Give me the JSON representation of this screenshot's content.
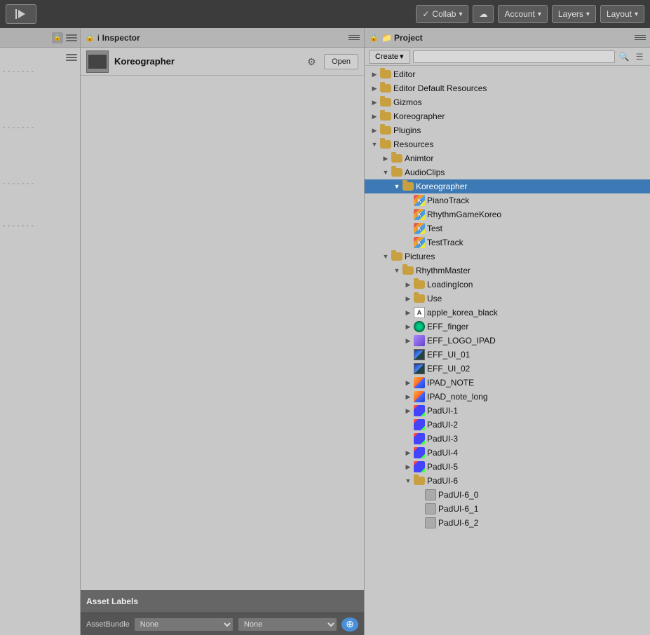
{
  "toolbar": {
    "play_label": "▶|",
    "collab_label": "Collab",
    "cloud_label": "☁",
    "account_label": "Account",
    "layers_label": "Layers",
    "layout_label": "Layout",
    "arrow": "▾"
  },
  "inspector": {
    "title": "Inspector",
    "asset_name": "Koreographer",
    "open_btn": "Open",
    "asset_labels": "Asset Labels",
    "asset_bundle_label": "AssetBundle",
    "asset_bundle_none1": "None",
    "asset_bundle_none2": "None"
  },
  "project": {
    "title": "Project",
    "create_btn": "Create",
    "tree": [
      {
        "id": "editor",
        "label": "Editor",
        "indent": 0,
        "type": "folder",
        "arrow": "▶",
        "selected": false
      },
      {
        "id": "editor-default-resources",
        "label": "Editor Default Resources",
        "indent": 0,
        "type": "folder",
        "arrow": "▶",
        "selected": false
      },
      {
        "id": "gizmos",
        "label": "Gizmos",
        "indent": 0,
        "type": "folder",
        "arrow": "▶",
        "selected": false
      },
      {
        "id": "koreographer-root",
        "label": "Koreographer",
        "indent": 0,
        "type": "folder",
        "arrow": "▶",
        "selected": false
      },
      {
        "id": "plugins",
        "label": "Plugins",
        "indent": 0,
        "type": "folder",
        "arrow": "▶",
        "selected": false
      },
      {
        "id": "resources",
        "label": "Resources",
        "indent": 0,
        "type": "folder-open",
        "arrow": "▼",
        "selected": false
      },
      {
        "id": "animtor",
        "label": "Animtor",
        "indent": 1,
        "type": "folder",
        "arrow": "▶",
        "selected": false
      },
      {
        "id": "audioclips",
        "label": "AudioClips",
        "indent": 1,
        "type": "folder-open",
        "arrow": "▼",
        "selected": false
      },
      {
        "id": "koreographer",
        "label": "Koreographer",
        "indent": 2,
        "type": "folder-open",
        "arrow": "▼",
        "selected": true
      },
      {
        "id": "pianotrack",
        "label": "PianoTrack",
        "indent": 3,
        "type": "koreo",
        "arrow": "",
        "selected": false
      },
      {
        "id": "rhythmgamekoreo",
        "label": "RhythmGameKoreo",
        "indent": 3,
        "type": "koreo",
        "arrow": "",
        "selected": false
      },
      {
        "id": "test",
        "label": "Test",
        "indent": 3,
        "type": "koreo",
        "arrow": "",
        "selected": false
      },
      {
        "id": "testtrack",
        "label": "TestTrack",
        "indent": 3,
        "type": "koreo",
        "arrow": "",
        "selected": false
      },
      {
        "id": "pictures",
        "label": "Pictures",
        "indent": 1,
        "type": "folder-open",
        "arrow": "▼",
        "selected": false
      },
      {
        "id": "rhythmmaster",
        "label": "RhythmMaster",
        "indent": 2,
        "type": "folder-open",
        "arrow": "▼",
        "selected": false
      },
      {
        "id": "loadingicon",
        "label": "LoadingIcon",
        "indent": 3,
        "type": "folder",
        "arrow": "▶",
        "selected": false
      },
      {
        "id": "use",
        "label": "Use",
        "indent": 3,
        "type": "folder",
        "arrow": "▶",
        "selected": false
      },
      {
        "id": "apple-korea-black",
        "label": "apple_korea_black",
        "indent": 3,
        "type": "text",
        "arrow": "▶",
        "selected": false
      },
      {
        "id": "eff-finger",
        "label": "EFF_finger",
        "indent": 3,
        "type": "circle",
        "arrow": "▶",
        "selected": false
      },
      {
        "id": "eff-logo-ipad",
        "label": "EFF_LOGO_IPAD",
        "indent": 3,
        "type": "star",
        "arrow": "▶",
        "selected": false
      },
      {
        "id": "eff-ui-01",
        "label": "EFF_UI_01",
        "indent": 3,
        "type": "imgdark",
        "arrow": "",
        "selected": false
      },
      {
        "id": "eff-ui-02",
        "label": "EFF_UI_02",
        "indent": 3,
        "type": "imgdark",
        "arrow": "",
        "selected": false
      },
      {
        "id": "ipad-note",
        "label": "IPAD_NOTE",
        "indent": 3,
        "type": "puzzle",
        "arrow": "▶",
        "selected": false
      },
      {
        "id": "ipad-note-long",
        "label": "IPAD_note_long",
        "indent": 3,
        "type": "puzzle",
        "arrow": "▶",
        "selected": false
      },
      {
        "id": "padui-1",
        "label": "PadUI-1",
        "indent": 3,
        "type": "pad",
        "arrow": "▶",
        "selected": false
      },
      {
        "id": "padui-2",
        "label": "PadUI-2",
        "indent": 3,
        "type": "pad",
        "arrow": "",
        "selected": false
      },
      {
        "id": "padui-3",
        "label": "PadUI-3",
        "indent": 3,
        "type": "pad",
        "arrow": "",
        "selected": false
      },
      {
        "id": "padui-4",
        "label": "PadUI-4",
        "indent": 3,
        "type": "pad",
        "arrow": "▶",
        "selected": false
      },
      {
        "id": "padui-5",
        "label": "PadUI-5",
        "indent": 3,
        "type": "pad",
        "arrow": "▶",
        "selected": false
      },
      {
        "id": "padui-6",
        "label": "PadUI-6",
        "indent": 3,
        "type": "folder-open",
        "arrow": "▼",
        "selected": false
      },
      {
        "id": "padui-6-0",
        "label": "PadUI-6_0",
        "indent": 4,
        "type": "gray-square",
        "arrow": "",
        "selected": false
      },
      {
        "id": "padui-6-1",
        "label": "PadUI-6_1",
        "indent": 4,
        "type": "gray-square",
        "arrow": "",
        "selected": false
      },
      {
        "id": "padui-6-2",
        "label": "PadUI-6_2",
        "indent": 4,
        "type": "gray-square",
        "arrow": "",
        "selected": false
      }
    ]
  }
}
